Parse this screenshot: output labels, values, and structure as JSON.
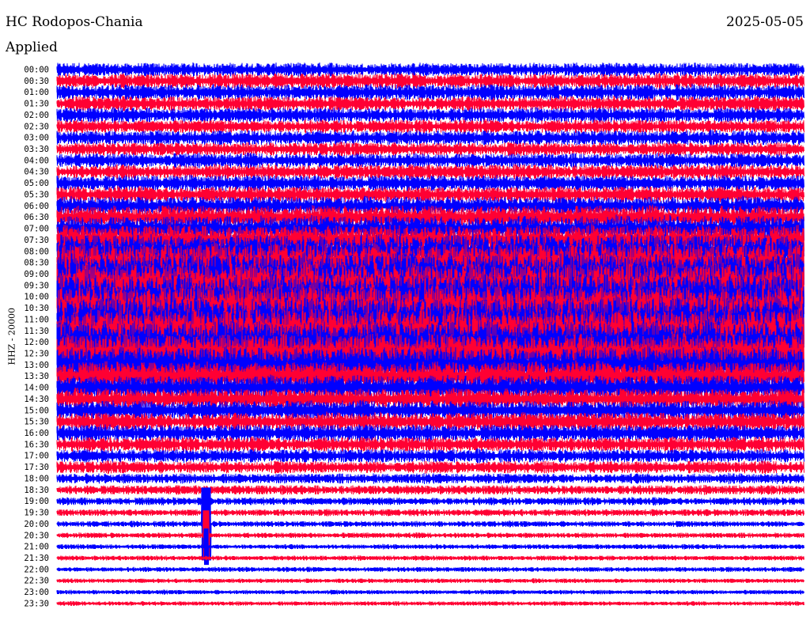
{
  "header": {
    "station": "HC Rodopos-Chania",
    "date": "2025-05-05",
    "filter_label": "Applied"
  },
  "chart_data": {
    "type": "line",
    "title": "HC Rodopos-Chania",
    "date": "2025-05-05",
    "ylabel": "HHZ - 20000",
    "tick_labels": [
      "00:00",
      "00:30",
      "01:00",
      "01:30",
      "02:00",
      "02:30",
      "03:00",
      "03:30",
      "04:00",
      "04:30",
      "05:00",
      "05:30",
      "06:00",
      "06:30",
      "07:00",
      "07:30",
      "08:00",
      "08:30",
      "09:00",
      "09:30",
      "10:00",
      "10:30",
      "11:00",
      "11:30",
      "12:00",
      "12:30",
      "13:00",
      "13:30",
      "14:00",
      "14:30",
      "15:00",
      "15:30",
      "16:00",
      "16:30",
      "17:00",
      "17:30",
      "18:00",
      "18:30",
      "19:00",
      "19:30",
      "20:00",
      "20:30",
      "21:00",
      "21:30",
      "22:00",
      "22:30",
      "23:00",
      "23:30"
    ],
    "trace_colors": [
      "#0000ff",
      "#ff0033"
    ],
    "row_amplitude": [
      0.55,
      0.6,
      0.65,
      0.6,
      0.6,
      0.55,
      0.6,
      0.55,
      0.6,
      0.6,
      0.65,
      0.65,
      0.75,
      0.95,
      1.05,
      1.2,
      1.4,
      1.6,
      1.75,
      1.85,
      1.9,
      1.9,
      1.85,
      1.8,
      1.75,
      1.65,
      1.45,
      1.2,
      1.0,
      0.85,
      0.8,
      0.75,
      0.7,
      0.6,
      0.55,
      0.5,
      0.42,
      0.38,
      0.32,
      0.28,
      0.24,
      0.22,
      0.2,
      0.2,
      0.2,
      0.18,
      0.18,
      0.18
    ],
    "event": {
      "time": "20:00",
      "minute_offset": 6
    },
    "grid": false
  }
}
